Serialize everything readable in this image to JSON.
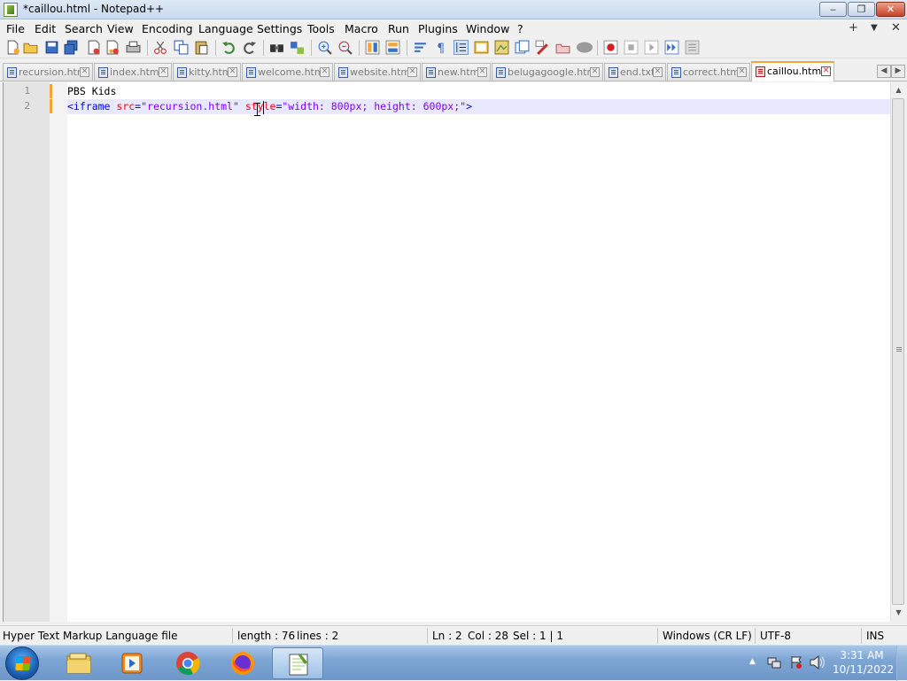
{
  "window": {
    "title": "*caillou.html - Notepad++",
    "controls": {
      "minimize": "‒",
      "restore": "❐",
      "close": "✕"
    }
  },
  "menu": {
    "items": [
      "File",
      "Edit",
      "Search",
      "View",
      "Encoding",
      "Language",
      "Settings",
      "Tools",
      "Macro",
      "Run",
      "Plugins",
      "Window",
      "?"
    ],
    "right": {
      "add": "+",
      "dropdown": "▼",
      "close": "✕"
    }
  },
  "toolbar": {
    "icons": [
      "new-file-icon",
      "open-file-icon",
      "save-icon",
      "save-all-icon",
      "close-icon",
      "close-all-icon",
      "print-icon",
      "cut-icon",
      "copy-icon",
      "paste-icon",
      "undo-icon",
      "redo-icon",
      "find-icon",
      "replace-icon",
      "zoom-in-icon",
      "zoom-out-icon",
      "sync-vertical-icon",
      "sync-horizontal-icon",
      "word-wrap-icon",
      "show-all-chars-icon",
      "indent-guide-icon",
      "udl-icon",
      "doc-map-icon",
      "function-list-icon",
      "folder-workspace-icon",
      "monitoring-icon",
      "record-macro-icon",
      "stop-macro-icon",
      "play-macro-icon",
      "run-macro-multiple-icon",
      "save-macro-icon"
    ]
  },
  "tabs": [
    {
      "label": "recursion.html",
      "active": false
    },
    {
      "label": "index.html",
      "active": false
    },
    {
      "label": "kitty.htm",
      "active": false
    },
    {
      "label": "welcome.html",
      "active": false
    },
    {
      "label": "website.html",
      "active": false
    },
    {
      "label": "new.htm",
      "active": false
    },
    {
      "label": "belugagoogle.html",
      "active": false
    },
    {
      "label": "end.txt",
      "active": false
    },
    {
      "label": "correct.html",
      "active": false
    },
    {
      "label": "caillou.html",
      "active": true
    }
  ],
  "tab_scroll": {
    "left": "◀",
    "right": "▶"
  },
  "editor": {
    "line_numbers": [
      "1",
      "2"
    ],
    "line1": {
      "text": "PBS Kids"
    },
    "line2": {
      "open": "<iframe",
      "attr1": " src",
      "eq1": "=",
      "val1": "\"recursion.html\"",
      "attr2": " style",
      "eq2": "=",
      "val2": "\"width: 800px; height: 600px;\"",
      "close": ">"
    }
  },
  "scrollbar": {
    "up": "▲",
    "down": "▼"
  },
  "status": {
    "file_type": "Hyper Text Markup Language file",
    "length": "length : 76",
    "lines": "lines : 2",
    "ln": "Ln : 2",
    "col": "Col : 28",
    "sel": "Sel : 1 | 1",
    "eol": "Windows (CR LF)",
    "encoding": "UTF-8",
    "mode": "INS"
  },
  "taskbar": {
    "apps": [
      "file-explorer-icon",
      "media-player-icon",
      "chrome-icon",
      "firefox-icon",
      "notepad-plus-plus-icon"
    ],
    "tray": {
      "show_hidden": "▲"
    },
    "clock": {
      "time": "3:31 AM",
      "date": "10/11/2022"
    }
  }
}
